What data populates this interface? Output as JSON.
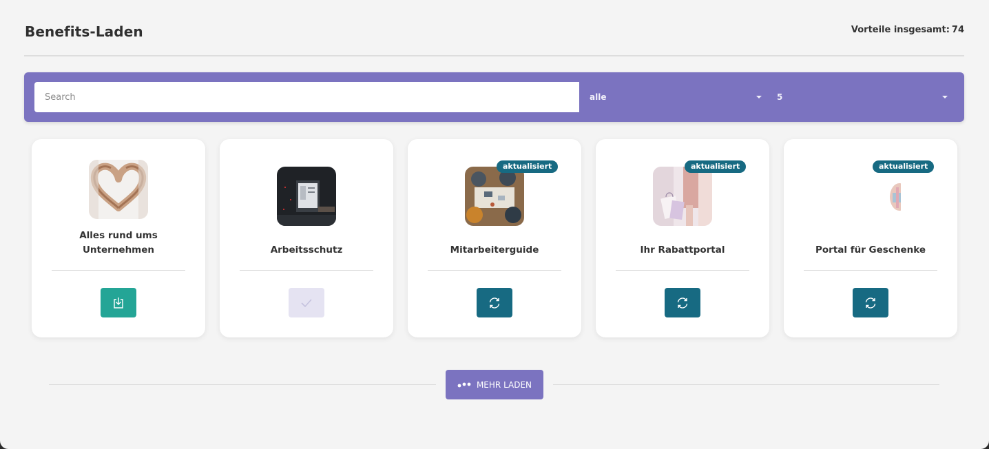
{
  "header": {
    "title": "Benefits-Laden",
    "total_label": "Vorteile insgesamt:",
    "total_value": "74"
  },
  "filters": {
    "search_placeholder": "Search",
    "search_value": "",
    "category_selected": "alle",
    "count_selected": "5"
  },
  "cards": [
    {
      "title": "Alles rund ums Unternehmen",
      "image": "heart-hands-image",
      "badge": "",
      "action": "install",
      "action_icon": "download-icon"
    },
    {
      "title": "Arbeitsschutz",
      "image": "computer-desk-image",
      "badge": "",
      "action": "installed",
      "action_icon": "check-icon"
    },
    {
      "title": "Mitarbeiterguide",
      "image": "team-meeting-image",
      "badge": "aktualisiert",
      "action": "update",
      "action_icon": "refresh-icon"
    },
    {
      "title": "Ihr Rabattportal",
      "image": "shopping-bags-image",
      "badge": "aktualisiert",
      "action": "update",
      "action_icon": "refresh-icon"
    },
    {
      "title": "Portal für Geschenke",
      "image": "gift-image",
      "badge": "aktualisiert",
      "action": "update",
      "action_icon": "refresh-icon"
    }
  ],
  "load_more": {
    "label": "MEHR LADEN",
    "icon": "dots-icon"
  },
  "colors": {
    "accent": "#7b73c0",
    "install": "#24a596",
    "update": "#176a82",
    "installed": "#e5e3f2",
    "background": "#f4f4f4"
  }
}
